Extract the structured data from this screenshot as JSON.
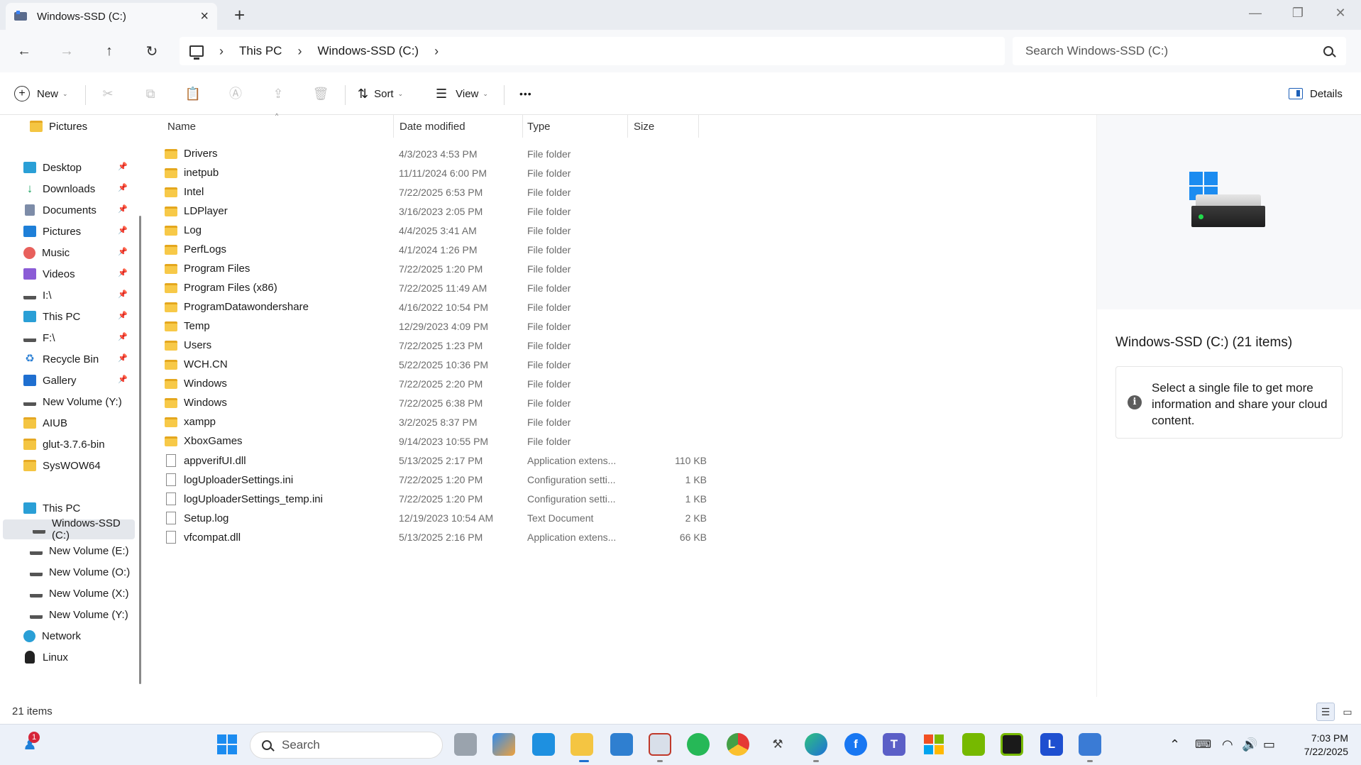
{
  "window": {
    "tab_title": "Windows-SSD (C:)",
    "tab_close": "×",
    "new_tab": "+",
    "minimize": "—",
    "restore": "❐",
    "close": "✕"
  },
  "nav": {
    "back": "←",
    "forward": "→",
    "up": "↑",
    "refresh": "↻"
  },
  "breadcrumb": {
    "sep": "›",
    "items": [
      "This PC",
      "Windows-SSD (C:)"
    ]
  },
  "search": {
    "placeholder": "Search Windows-SSD (C:)"
  },
  "commandbar": {
    "new": "New",
    "sort": "Sort",
    "view": "View",
    "more": "•••",
    "details": "Details",
    "chevron": "⌄"
  },
  "sidebar": {
    "items": [
      {
        "label": "Pictures",
        "icon": "folder-icon"
      },
      {
        "label": "Desktop",
        "icon": "desktop-icon",
        "pinned": true
      },
      {
        "label": "Downloads",
        "icon": "download-icon",
        "pinned": true
      },
      {
        "label": "Documents",
        "icon": "documents-icon",
        "pinned": true
      },
      {
        "label": "Pictures",
        "icon": "pictures-icon",
        "pinned": true
      },
      {
        "label": "Music",
        "icon": "music-icon",
        "pinned": true
      },
      {
        "label": "Videos",
        "icon": "videos-icon",
        "pinned": true
      },
      {
        "label": "I:\\",
        "icon": "drive-icon",
        "pinned": true
      },
      {
        "label": "This PC",
        "icon": "this-pc-icon",
        "pinned": true
      },
      {
        "label": "F:\\",
        "icon": "drive-icon",
        "pinned": true
      },
      {
        "label": "Recycle Bin",
        "icon": "recycle-bin-icon",
        "pinned": true
      },
      {
        "label": "Gallery",
        "icon": "gallery-icon",
        "pinned": true
      },
      {
        "label": "New Volume (Y:)",
        "icon": "drive-icon"
      },
      {
        "label": "AIUB",
        "icon": "folder-icon"
      },
      {
        "label": "glut-3.7.6-bin",
        "icon": "folder-icon"
      },
      {
        "label": "SysWOW64",
        "icon": "folder-icon"
      },
      {
        "label": "This PC",
        "icon": "this-pc-icon"
      },
      {
        "label": "Windows-SSD (C:)",
        "icon": "drive-icon",
        "selected": true
      },
      {
        "label": "New Volume (E:)",
        "icon": "drive-icon"
      },
      {
        "label": "New Volume (O:)",
        "icon": "drive-icon"
      },
      {
        "label": "New Volume (X:)",
        "icon": "drive-icon"
      },
      {
        "label": "New Volume (Y:)",
        "icon": "drive-icon"
      },
      {
        "label": "Network",
        "icon": "network-icon"
      },
      {
        "label": "Linux",
        "icon": "linux-icon"
      }
    ],
    "pin_glyph": "📌"
  },
  "columns": {
    "name": "Name",
    "date": "Date modified",
    "type": "Type",
    "size": "Size",
    "sort_caret": "^"
  },
  "files": [
    {
      "name": "Drivers",
      "date": "4/3/2023 4:53 PM",
      "type": "File folder",
      "size": "",
      "kind": "folder"
    },
    {
      "name": "inetpub",
      "date": "11/11/2024 6:00 PM",
      "type": "File folder",
      "size": "",
      "kind": "folder"
    },
    {
      "name": "Intel",
      "date": "7/22/2025 6:53 PM",
      "type": "File folder",
      "size": "",
      "kind": "folder"
    },
    {
      "name": "LDPlayer",
      "date": "3/16/2023 2:05 PM",
      "type": "File folder",
      "size": "",
      "kind": "folder"
    },
    {
      "name": "Log",
      "date": "4/4/2025 3:41 AM",
      "type": "File folder",
      "size": "",
      "kind": "folder"
    },
    {
      "name": "PerfLogs",
      "date": "4/1/2024 1:26 PM",
      "type": "File folder",
      "size": "",
      "kind": "folder"
    },
    {
      "name": "Program Files",
      "date": "7/22/2025 1:20 PM",
      "type": "File folder",
      "size": "",
      "kind": "folder"
    },
    {
      "name": "Program Files (x86)",
      "date": "7/22/2025 11:49 AM",
      "type": "File folder",
      "size": "",
      "kind": "folder"
    },
    {
      "name": "ProgramDatawondershare",
      "date": "4/16/2022 10:54 PM",
      "type": "File folder",
      "size": "",
      "kind": "folder"
    },
    {
      "name": "Temp",
      "date": "12/29/2023 4:09 PM",
      "type": "File folder",
      "size": "",
      "kind": "folder"
    },
    {
      "name": "Users",
      "date": "7/22/2025 1:23 PM",
      "type": "File folder",
      "size": "",
      "kind": "folder"
    },
    {
      "name": "WCH.CN",
      "date": "5/22/2025 10:36 PM",
      "type": "File folder",
      "size": "",
      "kind": "folder"
    },
    {
      "name": "Windows",
      "date": "7/22/2025 2:20 PM",
      "type": "File folder",
      "size": "",
      "kind": "folder"
    },
    {
      "name": "Windows",
      "date": "7/22/2025 6:38 PM",
      "type": "File folder",
      "size": "",
      "kind": "folder"
    },
    {
      "name": "xampp",
      "date": "3/2/2025 8:37 PM",
      "type": "File folder",
      "size": "",
      "kind": "folder"
    },
    {
      "name": "XboxGames",
      "date": "9/14/2023 10:55 PM",
      "type": "File folder",
      "size": "",
      "kind": "folder"
    },
    {
      "name": "appverifUI.dll",
      "date": "5/13/2025 2:17 PM",
      "type": "Application extens...",
      "size": "110 KB",
      "kind": "file"
    },
    {
      "name": "logUploaderSettings.ini",
      "date": "7/22/2025 1:20 PM",
      "type": "Configuration setti...",
      "size": "1 KB",
      "kind": "file"
    },
    {
      "name": "logUploaderSettings_temp.ini",
      "date": "7/22/2025 1:20 PM",
      "type": "Configuration setti...",
      "size": "1 KB",
      "kind": "file"
    },
    {
      "name": "Setup.log",
      "date": "12/19/2023 10:54 AM",
      "type": "Text Document",
      "size": "2 KB",
      "kind": "file"
    },
    {
      "name": "vfcompat.dll",
      "date": "5/13/2025 2:16 PM",
      "type": "Application extens...",
      "size": "66 KB",
      "kind": "file"
    }
  ],
  "details": {
    "title": "Windows-SSD (C:) (21 items)",
    "info_glyph": "i",
    "message": "Select a single file to get more information and share your cloud content."
  },
  "status": {
    "count": "21 items"
  },
  "taskbar": {
    "search_placeholder": "Search",
    "badge": "1",
    "apps": [
      "widgets-icon",
      "start-icon",
      "task-view-icon",
      "copilot-icon",
      "remote-icon",
      "file-explorer-icon",
      "photos-icon",
      "snipping-tool-icon",
      "whatsapp-icon",
      "chrome-icon",
      "tools-icon",
      "edge-icon",
      "facebook-icon",
      "teams-icon",
      "microsoft-store-icon",
      "nvidia-icon",
      "nvidia-app-icon",
      "l-app-icon",
      "app-icon"
    ],
    "l_app_label": "L",
    "time": "7:03 PM",
    "date": "7/22/2025"
  },
  "colors": {
    "accent": "#1c8cf0",
    "folder": "#f7c948",
    "titlebar": "#e9ecf1",
    "selected": "#e4e7ec"
  }
}
